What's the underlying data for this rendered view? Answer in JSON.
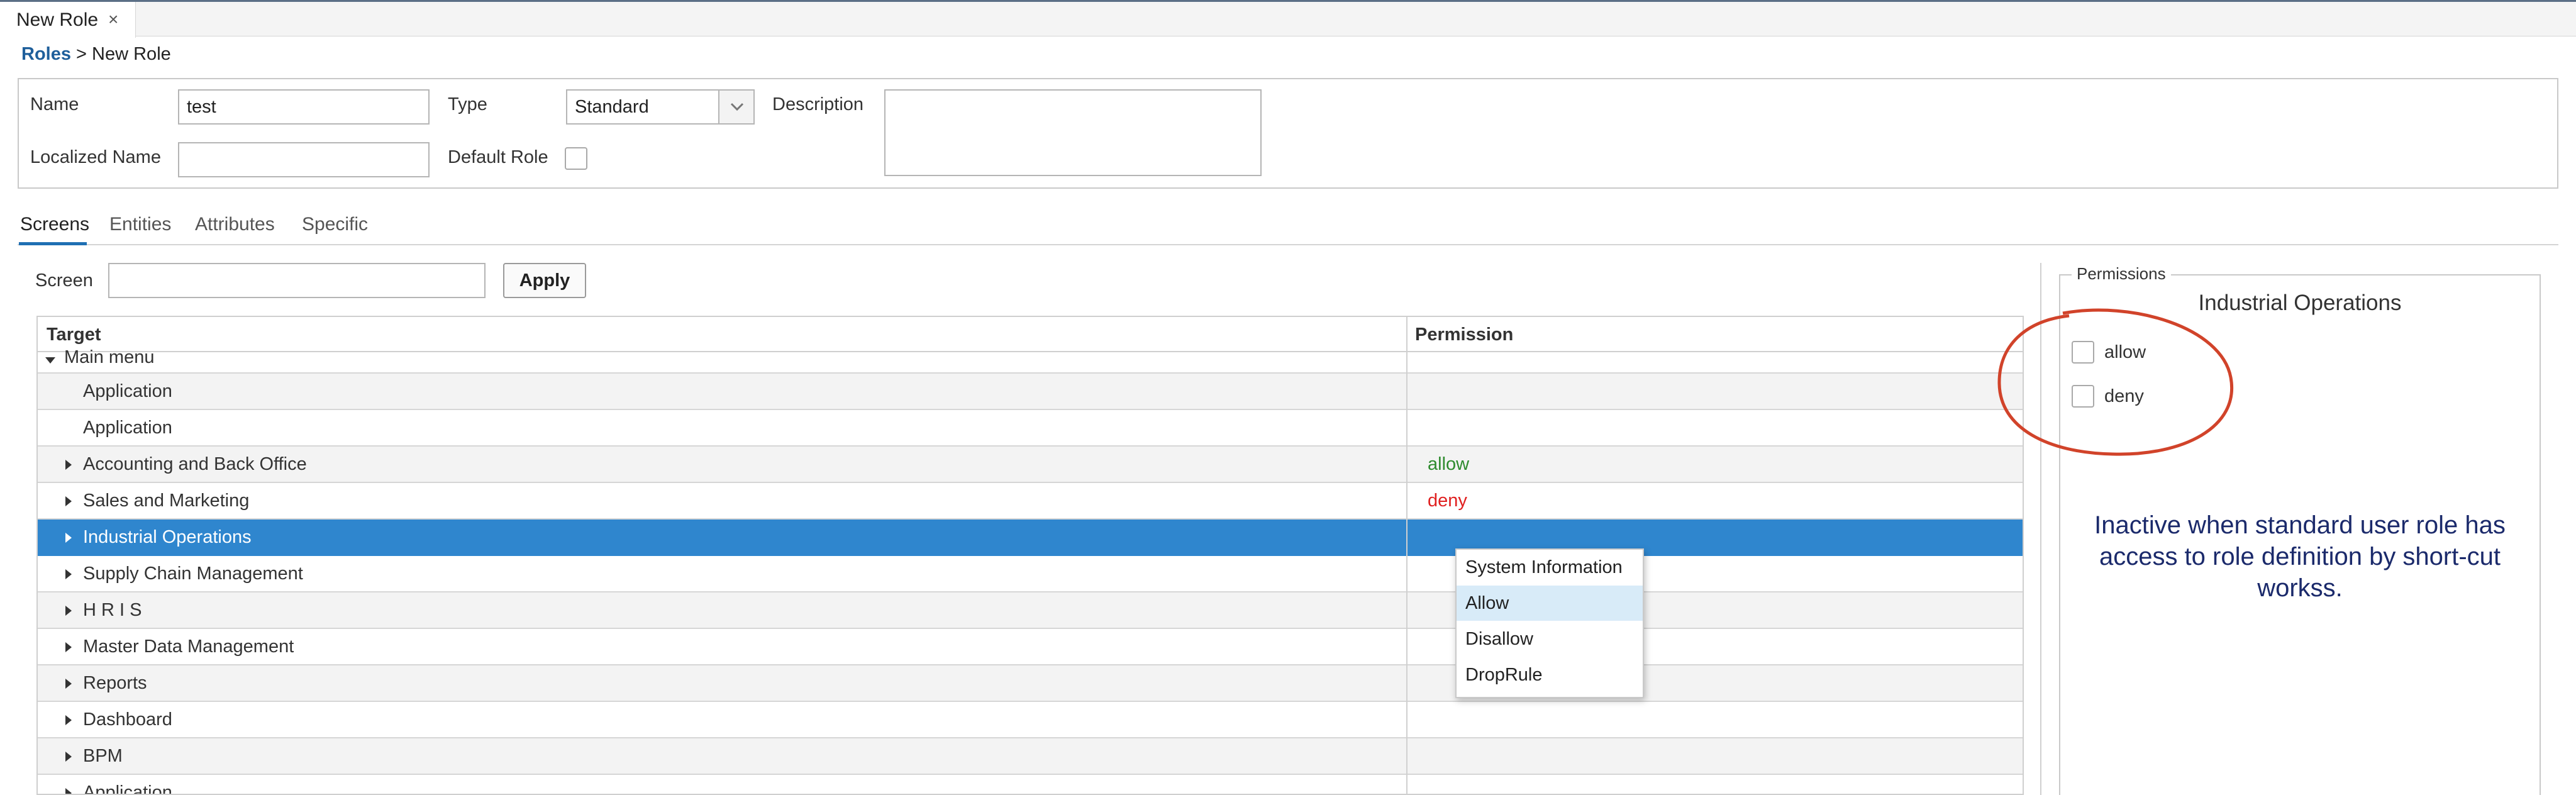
{
  "tab_strip": {
    "active_tab": "New Role",
    "close_icon": "×"
  },
  "breadcrumb": {
    "parent": "Roles",
    "separator": ">",
    "current": "New Role"
  },
  "form": {
    "name_label": "Name",
    "name_value": "test",
    "type_label": "Type",
    "type_value": "Standard",
    "description_label": "Description",
    "description_value": "",
    "localized_name_label": "Localized Name",
    "localized_name_value": "",
    "default_role_label": "Default Role",
    "default_role_checked": false
  },
  "tabs": [
    "Screens",
    "Entities",
    "Attributes",
    "Specific"
  ],
  "active_tab_index": 0,
  "screen_filter": {
    "label": "Screen",
    "value": "",
    "apply_label": "Apply"
  },
  "table": {
    "columns": [
      "Target",
      "Permission"
    ],
    "group_row": "Main menu",
    "rows": [
      {
        "label": "Application",
        "permission": "",
        "expandable": false
      },
      {
        "label": "Application",
        "permission": "",
        "expandable": false
      },
      {
        "label": "Accounting and Back Office",
        "permission": "allow",
        "expandable": true
      },
      {
        "label": "Sales and Marketing",
        "permission": "deny",
        "expandable": true
      },
      {
        "label": "Industrial Operations",
        "permission": "",
        "expandable": true,
        "selected": true
      },
      {
        "label": "Supply Chain Management",
        "permission": "",
        "expandable": true
      },
      {
        "label": "H R I S",
        "permission": "",
        "expandable": true
      },
      {
        "label": "Master Data Management",
        "permission": "",
        "expandable": true
      },
      {
        "label": "Reports",
        "permission": "",
        "expandable": true
      },
      {
        "label": "Dashboard",
        "permission": "",
        "expandable": true
      },
      {
        "label": "BPM",
        "permission": "",
        "expandable": true
      },
      {
        "label": "Application",
        "permission": "",
        "expandable": false
      }
    ]
  },
  "context_menu": {
    "items": [
      "System Information",
      "Allow",
      "Disallow",
      "DropRule"
    ],
    "highlighted_index": 1
  },
  "permissions_panel": {
    "legend": "Permissions",
    "title": "Industrial Operations",
    "allow_label": "allow",
    "deny_label": "deny",
    "note": "Inactive when standard user role has access to role definition by short-cut workss."
  },
  "colors": {
    "selection": "#2f86ce",
    "allow": "#2e8b2e",
    "deny": "#e02020",
    "annotation_circle": "#d1432a",
    "annotation_text": "#1b2a6b"
  },
  "icons": [
    "close-icon",
    "chevron-down-icon",
    "expand-arrow-icon",
    "collapse-arrow-icon"
  ]
}
